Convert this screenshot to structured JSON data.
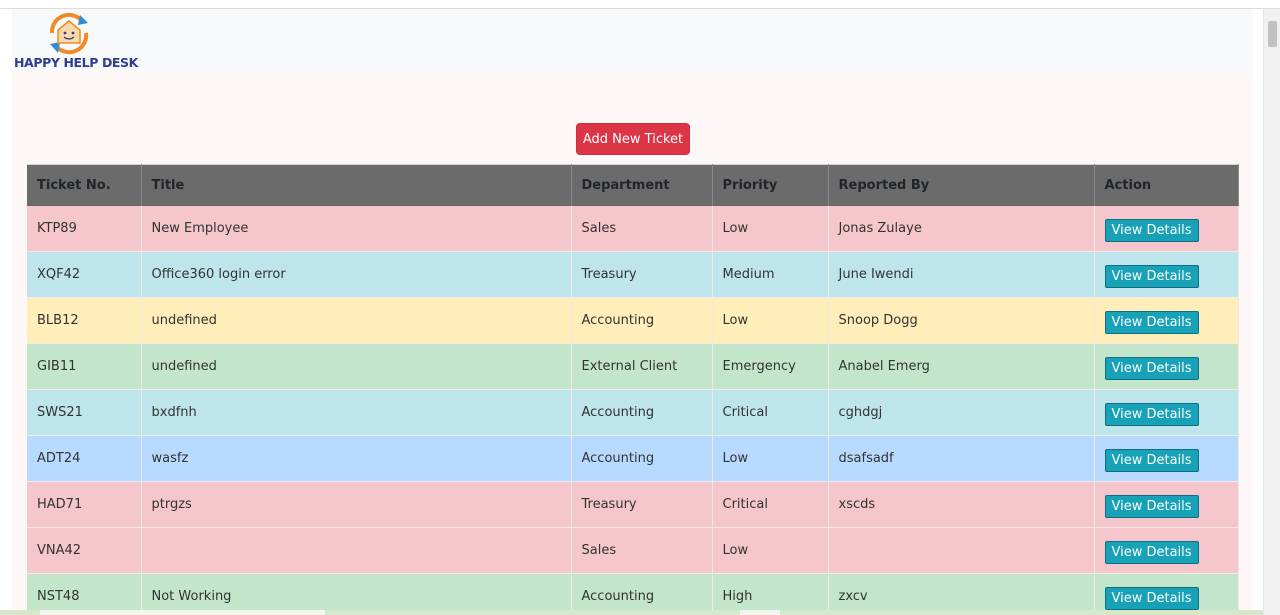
{
  "app": {
    "logo_text": "HAPPY HELP DESK"
  },
  "actions": {
    "add_ticket_label": "Add New Ticket"
  },
  "table": {
    "headers": [
      "Ticket No.",
      "Title",
      "Department",
      "Priority",
      "Reported By",
      "Action"
    ],
    "column_widths": [
      114,
      430,
      141,
      116,
      266,
      144
    ],
    "rows": [
      {
        "ticket": "KTP89",
        "title": "New Employee",
        "department": "Sales",
        "priority": "Low",
        "reported_by": "Jonas Zulaye",
        "action": "View Details",
        "bg": "#f5c6cb"
      },
      {
        "ticket": "XQF42",
        "title": "Office360 login error",
        "department": "Treasury",
        "priority": "Medium",
        "reported_by": "June Iwendi",
        "action": "View Details",
        "bg": "#bee5eb"
      },
      {
        "ticket": "BLB12",
        "title": "undefined",
        "department": "Accounting",
        "priority": "Low",
        "reported_by": "Snoop Dogg",
        "action": "View Details",
        "bg": "#ffeeba"
      },
      {
        "ticket": "GIB11",
        "title": "undefined",
        "department": "External Client",
        "priority": "Emergency",
        "reported_by": "Anabel Emerg",
        "action": "View Details",
        "bg": "#c3e6cb"
      },
      {
        "ticket": "SWS21",
        "title": "bxdfnh",
        "department": "Accounting",
        "priority": "Critical",
        "reported_by": "cghdgj",
        "action": "View Details",
        "bg": "#bee5eb"
      },
      {
        "ticket": "ADT24",
        "title": "wasfz",
        "department": "Accounting",
        "priority": "Low",
        "reported_by": "dsafsadf",
        "action": "View Details",
        "bg": "#b8daff"
      },
      {
        "ticket": "HAD71",
        "title": "ptrgzs",
        "department": "Treasury",
        "priority": "Critical",
        "reported_by": "xscds",
        "action": "View Details",
        "bg": "#f5c6cb"
      },
      {
        "ticket": "VNA42",
        "title": "",
        "department": "Sales",
        "priority": "Low",
        "reported_by": "",
        "action": "View Details",
        "bg": "#f5c6cb"
      },
      {
        "ticket": "NST48",
        "title": "Not Working",
        "department": "Accounting",
        "priority": "High",
        "reported_by": "zxcv",
        "action": "View Details",
        "bg": "#c3e6cb"
      }
    ]
  },
  "colors": {
    "header_bg": "#6b6b6b",
    "add_button": "#dc3545",
    "view_button": "#17a2b8",
    "logo_orange": "#f08a24",
    "logo_blue": "#2f3d8f"
  },
  "icons": {
    "logo": "house-smiley-logo-icon"
  }
}
